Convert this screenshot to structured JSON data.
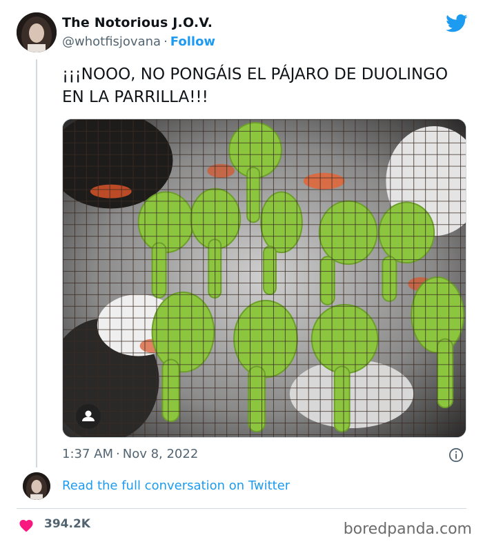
{
  "tweet": {
    "display_name": "The Notorious J.O.V.",
    "handle": "@whotfisjovana",
    "separator": "·",
    "follow_label": "Follow",
    "text": "¡¡¡NOOO, NO PONGÁIS EL PÁJARO DE DUOLINGO EN LA PARRILLA!!!",
    "time": "1:37 AM",
    "date": "Nov 8, 2022",
    "read_conversation_label": "Read the full conversation on Twitter",
    "like_count": "394.2K"
  },
  "icons": {
    "brand": "twitter-bird-icon",
    "info": "info-icon",
    "like": "heart-icon",
    "media_person": "person-icon"
  },
  "media": {
    "description_icon": "photo",
    "subject": "green drumsticks on grill"
  },
  "watermark": "boredpanda.com",
  "colors": {
    "link": "#1d9bf0",
    "secondary_text": "#536471",
    "heart": "#f91880",
    "green_food": "#8cc63f"
  }
}
